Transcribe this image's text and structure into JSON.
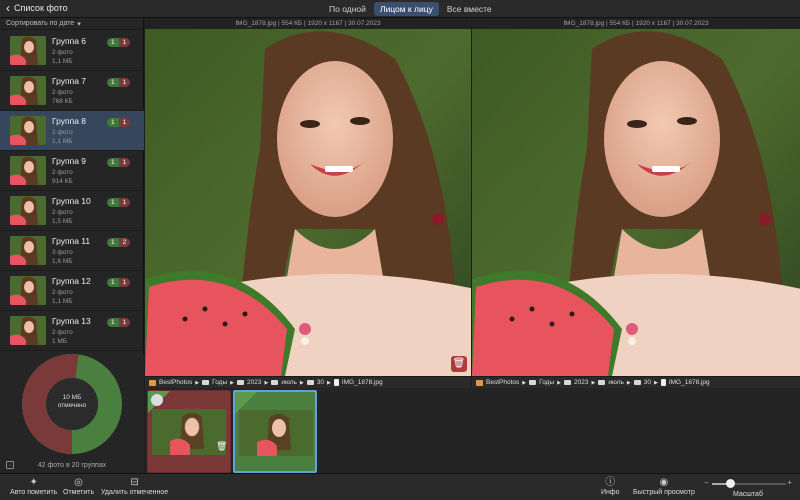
{
  "header": {
    "back_label": "Список фото",
    "tabs": [
      {
        "label": "По одной",
        "active": false
      },
      {
        "label": "Лицом к лицу",
        "active": true
      },
      {
        "label": "Все вместе",
        "active": false
      }
    ]
  },
  "sidebar": {
    "sort_label": "Сортировать по дате",
    "groups": [
      {
        "name": "Группа 6",
        "count": "2 фото",
        "size": "1,1 МБ",
        "green": "1",
        "red": "1",
        "selected": false
      },
      {
        "name": "Группа 7",
        "count": "2 фото",
        "size": "768 КБ",
        "green": "1",
        "red": "1",
        "selected": false
      },
      {
        "name": "Группа 8",
        "count": "2 фото",
        "size": "1,1 МБ",
        "green": "1",
        "red": "1",
        "selected": true
      },
      {
        "name": "Группа 9",
        "count": "2 фото",
        "size": "914 КБ",
        "green": "1",
        "red": "1",
        "selected": false
      },
      {
        "name": "Группа 10",
        "count": "2 фото",
        "size": "1,5 МБ",
        "green": "1",
        "red": "1",
        "selected": false
      },
      {
        "name": "Группа 11",
        "count": "3 фото",
        "size": "1,6 МБ",
        "green": "1",
        "red": "2",
        "selected": false
      },
      {
        "name": "Группа 12",
        "count": "2 фото",
        "size": "1,1 МБ",
        "green": "1",
        "red": "1",
        "selected": false
      },
      {
        "name": "Группа 13",
        "count": "2 фото",
        "size": "1 МБ",
        "green": "1",
        "red": "1",
        "selected": false
      }
    ],
    "donut": {
      "line1": "10 МБ",
      "line2": "отмечено",
      "marked_fraction": 0.52,
      "marked_color": "#7a3a3a",
      "kept_color": "#4a7f3f"
    },
    "summary": "42 фото в 20 группах"
  },
  "panes": {
    "left": {
      "info": "IMG_1878.jpg | 554 КБ | 1920 x 1167 | 30.07.2023"
    },
    "right": {
      "info": "IMG_1878.jpg | 554 КБ | 1920 x 1167 | 30.07.2023"
    }
  },
  "path": {
    "segments": [
      "BestPhotos",
      "Годы",
      "2023",
      "июль",
      "30",
      "IMG_1878.jpg"
    ]
  },
  "toolbar": {
    "auto_mark": "Авто пометить",
    "mark": "Отметить",
    "delete_marked": "Удалить отмеченное",
    "info": "Инфо",
    "quick_view": "Быстрый просмотр",
    "scale": "Масштаб",
    "scale_level": 0.25,
    "minus": "−",
    "plus": "+"
  },
  "colors": {
    "accent": "#3a4e6d",
    "selected_row": "#36465d",
    "green": "#3f7a3a",
    "red": "#7a3a3a"
  }
}
